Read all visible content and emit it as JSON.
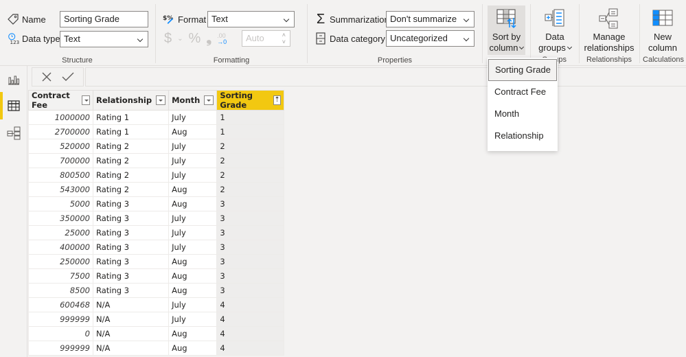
{
  "ribbon": {
    "structure": {
      "label": "Structure",
      "name_label": "Name",
      "name_value": "Sorting Grade",
      "datatype_label": "Data type",
      "datatype_value": "Text"
    },
    "formatting": {
      "label": "Formatting",
      "format_label": "Format",
      "format_value": "Text",
      "currency_symbol": "$",
      "percent_symbol": "%",
      "comma_symbol": "❟",
      "decimals_symbol": ".00",
      "auto_placeholder": "Auto"
    },
    "properties": {
      "label": "Properties",
      "summarization_label": "Summarization",
      "summarization_value": "Don't summarize",
      "category_label": "Data category",
      "category_value": "Uncategorized"
    },
    "sort": {
      "line1": "Sort by",
      "line2": "column"
    },
    "groups": {
      "line1": "Data",
      "line2": "groups",
      "label": "Groups"
    },
    "relationships": {
      "line1": "Manage",
      "line2": "relationships",
      "label": "Relationships"
    },
    "calculations": {
      "line1": "New",
      "line2": "column",
      "label": "Calculations"
    }
  },
  "sort_menu": {
    "items": [
      "Sorting Grade",
      "Contract Fee",
      "Month",
      "Relationship"
    ],
    "highlighted": "Sorting Grade"
  },
  "table": {
    "columns": [
      "Contract Fee",
      "Relationship",
      "Month",
      "Sorting Grade"
    ],
    "sorted_column": "Sorting Grade",
    "rows": [
      [
        "1000000",
        "Rating 1",
        "July",
        "1"
      ],
      [
        "2700000",
        "Rating 1",
        "Aug",
        "1"
      ],
      [
        "520000",
        "Rating 2",
        "July",
        "2"
      ],
      [
        "700000",
        "Rating 2",
        "July",
        "2"
      ],
      [
        "800500",
        "Rating 2",
        "July",
        "2"
      ],
      [
        "543000",
        "Rating 2",
        "Aug",
        "2"
      ],
      [
        "5000",
        "Rating 3",
        "Aug",
        "3"
      ],
      [
        "350000",
        "Rating 3",
        "July",
        "3"
      ],
      [
        "25000",
        "Rating 3",
        "July",
        "3"
      ],
      [
        "400000",
        "Rating 3",
        "July",
        "3"
      ],
      [
        "250000",
        "Rating 3",
        "Aug",
        "3"
      ],
      [
        "7500",
        "Rating 3",
        "Aug",
        "3"
      ],
      [
        "8500",
        "Rating 3",
        "Aug",
        "3"
      ],
      [
        "600468",
        "N/A",
        "July",
        "4"
      ],
      [
        "999999",
        "N/A",
        "July",
        "4"
      ],
      [
        "0",
        "N/A",
        "Aug",
        "4"
      ],
      [
        "999999",
        "N/A",
        "Aug",
        "4"
      ]
    ]
  },
  "rail": [
    "report-view",
    "data-view",
    "model-view"
  ],
  "colors": {
    "accent": "#f2c811",
    "blue": "#118dff"
  }
}
